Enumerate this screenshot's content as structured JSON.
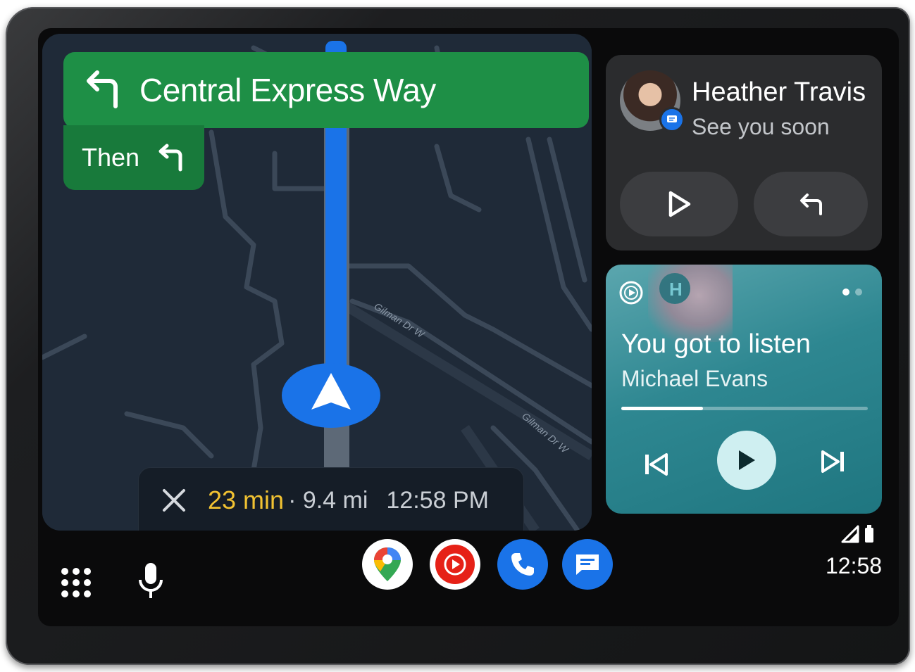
{
  "navigation": {
    "turn_street": "Central Express Way",
    "then_label": "Then",
    "map_street_label_1": "Gilman Dr W",
    "map_street_label_2": "Gilman Dr W",
    "eta_time": "23 min",
    "eta_distance": "· 9.4 mi",
    "eta_arrival": "12:58 PM",
    "icons": {
      "turn": "turn-left-icon",
      "then": "turn-left-icon",
      "close": "close-icon",
      "position": "navigation-arrow-icon"
    },
    "colors": {
      "turn_card": "#1e8f46",
      "route": "#1a73e8",
      "eta_time": "#f1c232"
    }
  },
  "message": {
    "contact_name": "Heather Travis",
    "preview": "See you soon",
    "actions": [
      "play-icon",
      "reply-icon"
    ]
  },
  "media": {
    "title": "You got to listen",
    "artist": "Michael Evans",
    "progress": 0.33,
    "page_count": 2,
    "active_page": 1,
    "album_letter": "H",
    "controls": [
      "skip-previous-icon",
      "play-icon",
      "skip-next-icon"
    ]
  },
  "dock": {
    "apps": [
      "google-maps-icon",
      "youtube-music-icon",
      "phone-icon",
      "messages-icon"
    ],
    "left_controls": [
      "app-launcher-icon",
      "microphone-icon"
    ]
  },
  "status": {
    "clock": "12:58",
    "icons": [
      "signal-icon",
      "battery-icon"
    ]
  }
}
